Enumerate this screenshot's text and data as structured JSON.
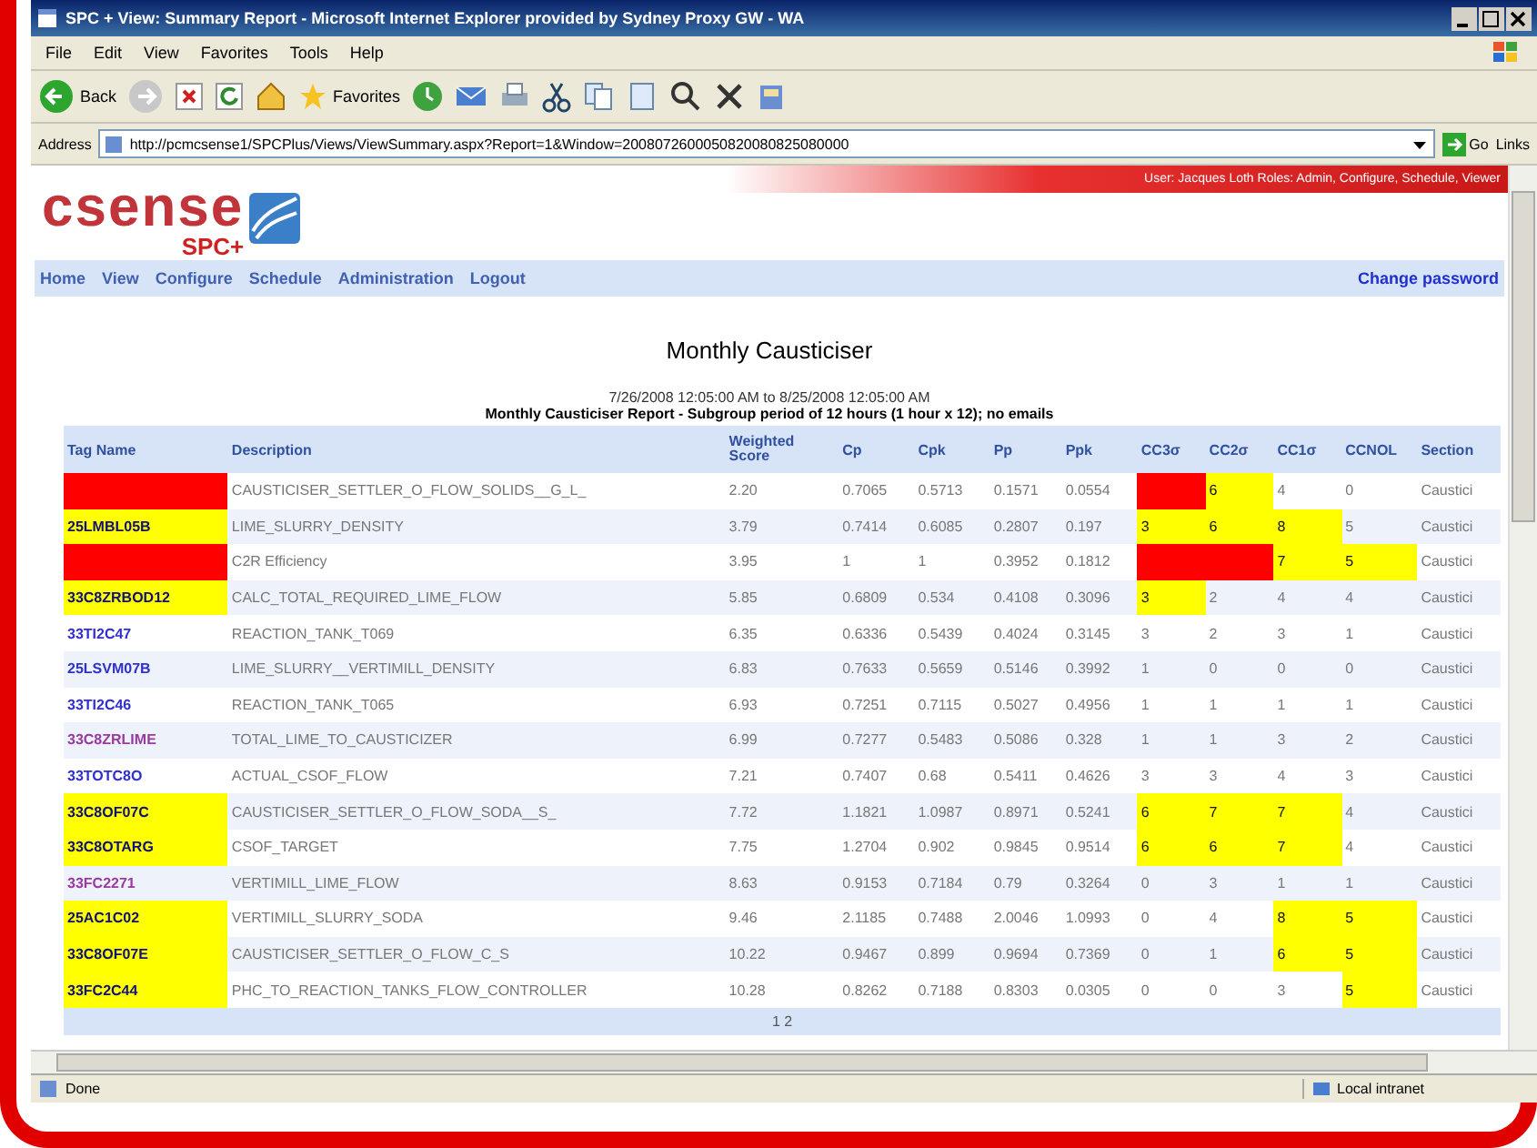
{
  "window": {
    "title": "SPC + View: Summary Report - Microsoft Internet Explorer provided by Sydney Proxy GW - WA"
  },
  "menu": [
    "File",
    "Edit",
    "View",
    "Favorites",
    "Tools",
    "Help"
  ],
  "toolbar": {
    "back_label": "Back",
    "favorites_label": "Favorites"
  },
  "address": {
    "label": "Address",
    "value": "http://pcmcsense1/SPCPlus/Views/ViewSummary.aspx?Report=1&Window=2008072600050820080825080000",
    "go": "Go",
    "links": "Links"
  },
  "site": {
    "logo_word": "csense",
    "logo_sub": "SPC+",
    "user_bar": "User: Jacques Loth Roles: Admin, Configure, Schedule, Viewer",
    "nav": [
      "Home",
      "View",
      "Configure",
      "Schedule",
      "Administration",
      "Logout"
    ],
    "change_password": "Change password"
  },
  "report": {
    "title": "Monthly Causticiser",
    "period": "7/26/2008 12:05:00 AM to 8/25/2008 12:05:00 AM",
    "subtitle": "Monthly Causticiser Report - Subgroup period of 12 hours (1 hour x 12); no emails"
  },
  "table": {
    "columns": [
      "Tag Name",
      "Description",
      "Weighted Score",
      "Cp",
      "Cpk",
      "Pp",
      "Ppk",
      "CC3σ",
      "CC2σ",
      "CC1σ",
      "CCNOL",
      "Section"
    ],
    "rows": [
      {
        "tag": {
          "color": "#ff0000"
        },
        "description": "CAUSTICISER_SETTLER_O_FLOW_SOLIDS__G_L_",
        "values": [
          "2.20",
          "0.7065",
          "0.5713",
          "0.1571",
          "0.0554"
        ],
        "cc": [
          {
            "color": "#ff0000"
          },
          {
            "text": "6",
            "color": "#ffff00"
          },
          {
            "text": "4"
          },
          {
            "text": "0"
          }
        ],
        "section": "Caustici"
      },
      {
        "tag": {
          "text": "25LMBL05B",
          "color": "#ffff00",
          "visited": false
        },
        "description": "LIME_SLURRY_DENSITY",
        "values": [
          "3.79",
          "0.7414",
          "0.6085",
          "0.2807",
          "0.197"
        ],
        "cc": [
          {
            "text": "3",
            "color": "#ffff00"
          },
          {
            "text": "6",
            "color": "#ffff00"
          },
          {
            "text": "8",
            "color": "#ffff00"
          },
          {
            "text": "5"
          }
        ],
        "section": "Caustici"
      },
      {
        "tag": {
          "color": "#ff0000"
        },
        "description": "C2R Efficiency",
        "values": [
          "3.95",
          "1",
          "1",
          "0.3952",
          "0.1812"
        ],
        "cc": [
          {
            "color": "#ff0000"
          },
          {
            "color": "#ff0000"
          },
          {
            "text": "7",
            "color": "#ffff00"
          },
          {
            "text": "5",
            "color": "#ffff00"
          }
        ],
        "section": "Caustici"
      },
      {
        "tag": {
          "text": "33C8ZRBOD12",
          "color": "#ffff00",
          "visited": false
        },
        "description": "CALC_TOTAL_REQUIRED_LIME_FLOW",
        "values": [
          "5.85",
          "0.6809",
          "0.534",
          "0.4108",
          "0.3096"
        ],
        "cc": [
          {
            "text": "3",
            "color": "#ffff00"
          },
          {
            "text": "2"
          },
          {
            "text": "4"
          },
          {
            "text": "4"
          }
        ],
        "section": "Caustici"
      },
      {
        "tag": {
          "text": "33TI2C47",
          "visited": false
        },
        "description": "REACTION_TANK_T069",
        "values": [
          "6.35",
          "0.6336",
          "0.5439",
          "0.4024",
          "0.3145"
        ],
        "cc": [
          {
            "text": "3"
          },
          {
            "text": "2"
          },
          {
            "text": "3"
          },
          {
            "text": "1"
          }
        ],
        "section": "Caustici"
      },
      {
        "tag": {
          "text": "25LSVM07B",
          "visited": false
        },
        "description": "LIME_SLURRY__VERTIMILL_DENSITY",
        "values": [
          "6.83",
          "0.7633",
          "0.5659",
          "0.5146",
          "0.3992"
        ],
        "cc": [
          {
            "text": "1"
          },
          {
            "text": "0"
          },
          {
            "text": "0"
          },
          {
            "text": "0"
          }
        ],
        "section": "Caustici"
      },
      {
        "tag": {
          "text": "33TI2C46",
          "visited": false
        },
        "description": "REACTION_TANK_T065",
        "values": [
          "6.93",
          "0.7251",
          "0.7115",
          "0.5027",
          "0.4956"
        ],
        "cc": [
          {
            "text": "1"
          },
          {
            "text": "1"
          },
          {
            "text": "1"
          },
          {
            "text": "1"
          }
        ],
        "section": "Caustici"
      },
      {
        "tag": {
          "text": "33C8ZRLIME",
          "visited": true
        },
        "description": "TOTAL_LIME_TO_CAUSTICIZER",
        "values": [
          "6.99",
          "0.7277",
          "0.5483",
          "0.5086",
          "0.328"
        ],
        "cc": [
          {
            "text": "1"
          },
          {
            "text": "1"
          },
          {
            "text": "3"
          },
          {
            "text": "2"
          }
        ],
        "section": "Caustici"
      },
      {
        "tag": {
          "text": "33TOTC8O",
          "visited": false
        },
        "description": "ACTUAL_CSOF_FLOW",
        "values": [
          "7.21",
          "0.7407",
          "0.68",
          "0.5411",
          "0.4626"
        ],
        "cc": [
          {
            "text": "3"
          },
          {
            "text": "3"
          },
          {
            "text": "4"
          },
          {
            "text": "3"
          }
        ],
        "section": "Caustici"
      },
      {
        "tag": {
          "text": "33C8OF07C",
          "color": "#ffff00",
          "visited": false
        },
        "description": "CAUSTICISER_SETTLER_O_FLOW_SODA__S_",
        "values": [
          "7.72",
          "1.1821",
          "1.0987",
          "0.8971",
          "0.5241"
        ],
        "cc": [
          {
            "text": "6",
            "color": "#ffff00"
          },
          {
            "text": "7",
            "color": "#ffff00"
          },
          {
            "text": "7",
            "color": "#ffff00"
          },
          {
            "text": "4"
          }
        ],
        "section": "Caustici"
      },
      {
        "tag": {
          "text": "33C8OTARG",
          "color": "#ffff00",
          "visited": false
        },
        "description": "CSOF_TARGET",
        "values": [
          "7.75",
          "1.2704",
          "0.902",
          "0.9845",
          "0.9514"
        ],
        "cc": [
          {
            "text": "6",
            "color": "#ffff00"
          },
          {
            "text": "6",
            "color": "#ffff00"
          },
          {
            "text": "7",
            "color": "#ffff00"
          },
          {
            "text": "4"
          }
        ],
        "section": "Caustici"
      },
      {
        "tag": {
          "text": "33FC2271",
          "visited": true
        },
        "description": "VERTIMILL_LIME_FLOW",
        "values": [
          "8.63",
          "0.9153",
          "0.7184",
          "0.79",
          "0.3264"
        ],
        "cc": [
          {
            "text": "0"
          },
          {
            "text": "3"
          },
          {
            "text": "1"
          },
          {
            "text": "1"
          }
        ],
        "section": "Caustici"
      },
      {
        "tag": {
          "text": "25AC1C02",
          "color": "#ffff00",
          "visited": false
        },
        "description": "VERTIMILL_SLURRY_SODA",
        "values": [
          "9.46",
          "2.1185",
          "0.7488",
          "2.0046",
          "1.0993"
        ],
        "cc": [
          {
            "text": "0"
          },
          {
            "text": "4"
          },
          {
            "text": "8",
            "color": "#ffff00"
          },
          {
            "text": "5",
            "color": "#ffff00"
          }
        ],
        "section": "Caustici"
      },
      {
        "tag": {
          "text": "33C8OF07E",
          "color": "#ffff00",
          "visited": false
        },
        "description": "CAUSTICISER_SETTLER_O_FLOW_C_S",
        "values": [
          "10.22",
          "0.9467",
          "0.899",
          "0.9694",
          "0.7369"
        ],
        "cc": [
          {
            "text": "0"
          },
          {
            "text": "1"
          },
          {
            "text": "6",
            "color": "#ffff00"
          },
          {
            "text": "5",
            "color": "#ffff00"
          }
        ],
        "section": "Caustici"
      },
      {
        "tag": {
          "text": "33FC2C44",
          "color": "#ffff00",
          "visited": false
        },
        "description": "PHC_TO_REACTION_TANKS_FLOW_CONTROLLER",
        "values": [
          "10.28",
          "0.8262",
          "0.7188",
          "0.8303",
          "0.0305"
        ],
        "cc": [
          {
            "text": "0"
          },
          {
            "text": "0"
          },
          {
            "text": "3"
          },
          {
            "text": "5",
            "color": "#ffff00"
          }
        ],
        "section": "Caustici"
      }
    ]
  },
  "pager": "1 2",
  "status_bar": {
    "text": "Done",
    "zone": "Local intranet"
  }
}
